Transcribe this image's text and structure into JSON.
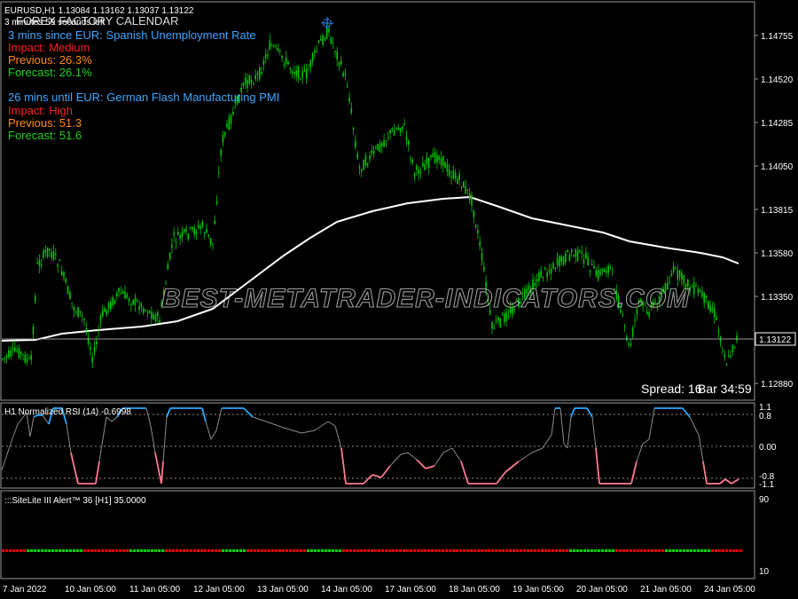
{
  "header": {
    "symbol_line": "EURUSD,H1  1.13084 1.13162 1.13037 1.13122",
    "countdown": "3 minutes 59 seconds left",
    "indicator_title": "FOREX FACTORY CALENDAR"
  },
  "news": [
    {
      "headline": "3 mins since EUR: Spanish Unemployment Rate",
      "impact": "Impact: Medium",
      "previous": "Previous: 26.3%",
      "forecast": "Forecast: 26.1%"
    },
    {
      "headline": "26 mins until EUR: German Flash Manufacturing PMI",
      "impact": "Impact: High",
      "previous": "Previous: 51.3",
      "forecast": "Forecast: 51.6"
    }
  ],
  "watermark": "BEST-METATRADER-INDICATORS.COM",
  "status": {
    "spread": "Spread: 16",
    "bar_timer": "Bar  34:59"
  },
  "price_axis": {
    "labels": [
      "1.14755",
      "1.14520",
      "1.14285",
      "1.14050",
      "1.13815",
      "1.13580",
      "1.13350",
      "1.12880"
    ],
    "current_price": "1.13122"
  },
  "rsi_panel": {
    "title": "H1 Normalized RSI (14) -0.6998",
    "levels": [
      "1.1",
      "0.8",
      "0.00",
      "-0.8",
      "-1.1"
    ]
  },
  "alert_panel": {
    "title": ":::SiteLite III Alert™ 36 [H1] 35.0000",
    "levels": [
      "90",
      "10"
    ]
  },
  "time_axis": [
    "7 Jan 2022",
    "10 Jan 05:00",
    "11 Jan 05:00",
    "12 Jan 05:00",
    "13 Jan 05:00",
    "14 Jan 05:00",
    "17 Jan 05:00",
    "18 Jan 05:00",
    "19 Jan 05:00",
    "20 Jan 05:00",
    "21 Jan 05:00",
    "24 Jan 05:00"
  ],
  "colors": {
    "background": "#000000",
    "candles": "#00c800",
    "moving_average": "#ffffff",
    "rsi_overbought": "#2aa8ff",
    "rsi_oversold": "#ff7a8e",
    "rsi_neutral": "#8c8c8c",
    "news_headline": "#3da6ff",
    "impact": "#ff2020",
    "previous": "#ff8c1a",
    "forecast": "#1fd11f",
    "alert_up": "#00d000",
    "alert_down": "#e00000"
  }
}
